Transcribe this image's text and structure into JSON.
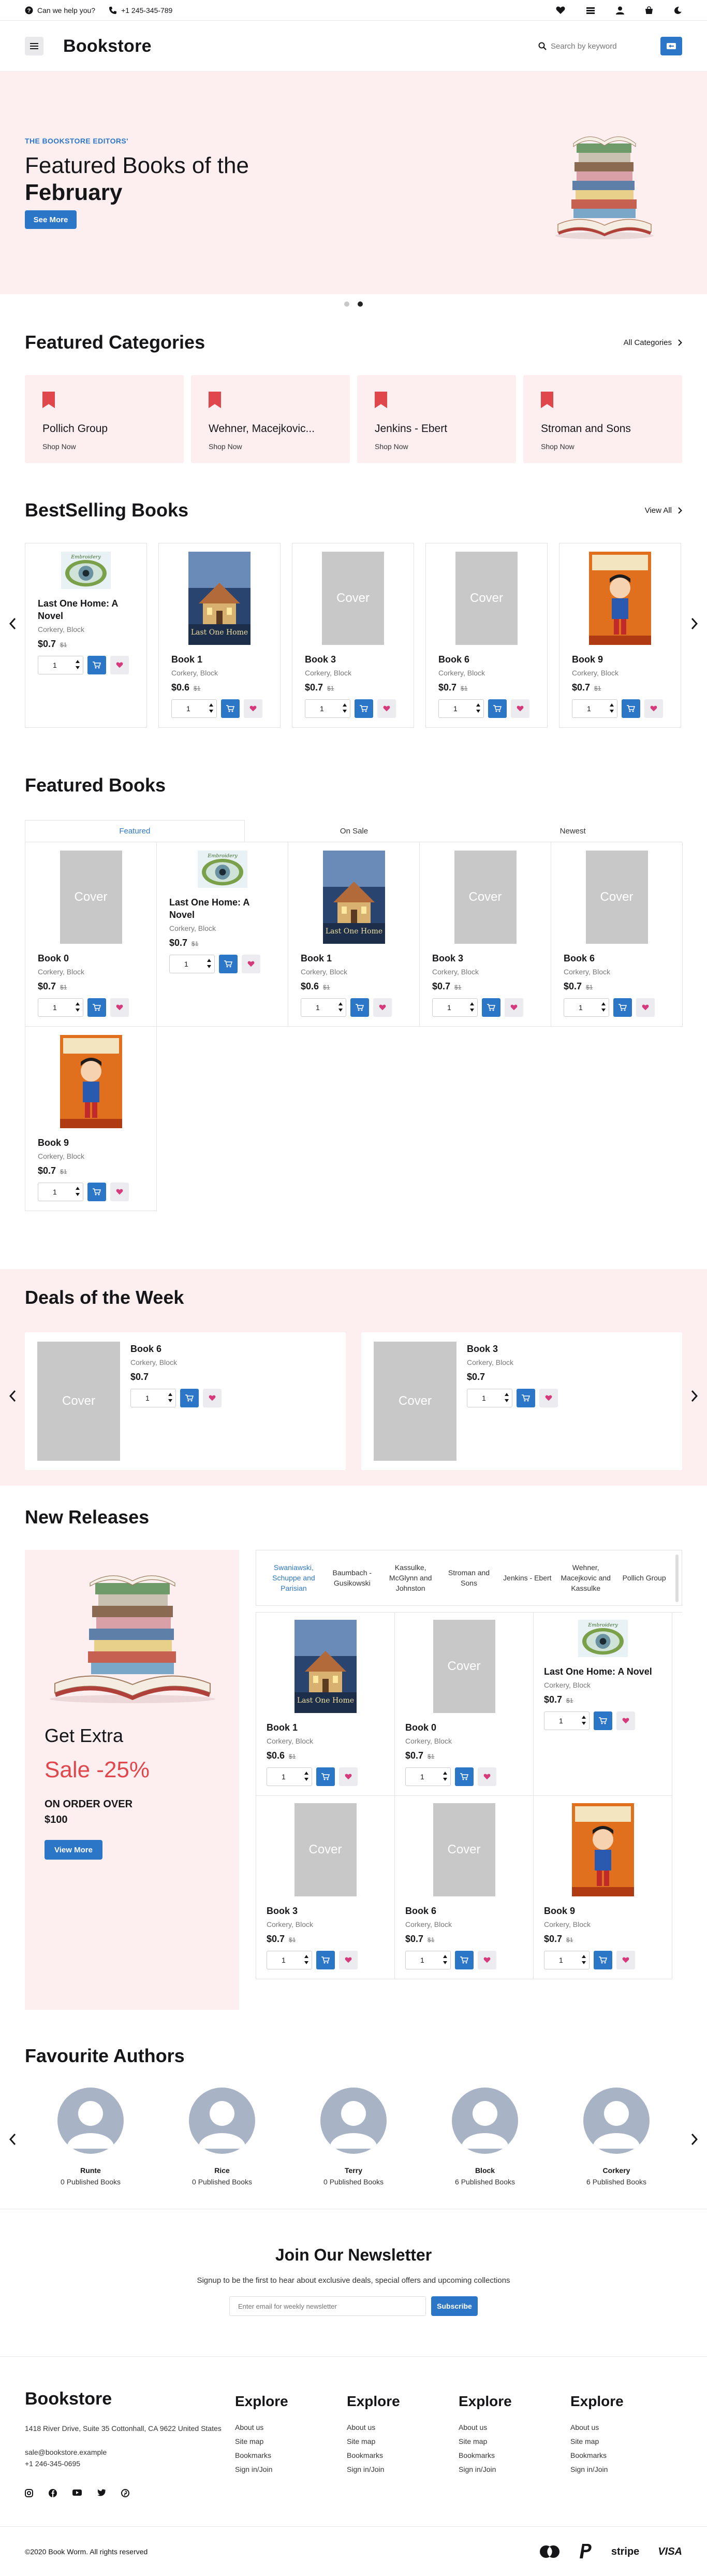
{
  "topbar": {
    "help": "Can we help you?",
    "phone": "+1 245-345-789"
  },
  "header": {
    "logo": "Bookstore",
    "search_placeholder": "Search by keyword"
  },
  "hero": {
    "eyebrow": "THE BOOKSTORE EDITORS'",
    "title_line1": "Featured Books of the",
    "title_line2": "February",
    "cta": "See More"
  },
  "categories": {
    "title": "Featured Categories",
    "link": "All Categories",
    "items": [
      {
        "name": "Pollich Group",
        "cta": "Shop Now"
      },
      {
        "name": "Wehner, Macejkovic...",
        "cta": "Shop Now"
      },
      {
        "name": "Jenkins - Ebert",
        "cta": "Shop Now"
      },
      {
        "name": "Stroman and Sons",
        "cta": "Shop Now"
      }
    ]
  },
  "bestselling": {
    "title": "BestSelling Books",
    "link": "View All",
    "items": [
      {
        "title": "Last One Home: A Novel",
        "author": "Corkery, Block",
        "price": "$0.7",
        "old": "$1",
        "qty": "1",
        "cover": "eye"
      },
      {
        "title": "Book 1",
        "author": "Corkery, Block",
        "price": "$0.6",
        "old": "$1",
        "qty": "1",
        "cover": "house",
        "cover_text": "Last One Home"
      },
      {
        "title": "Book 3",
        "author": "Corkery, Block",
        "price": "$0.7",
        "old": "$1",
        "qty": "1",
        "cover": "placeholder"
      },
      {
        "title": "Book 6",
        "author": "Corkery, Block",
        "price": "$0.7",
        "old": "$1",
        "qty": "1",
        "cover": "placeholder"
      },
      {
        "title": "Book 9",
        "author": "Corkery, Block",
        "price": "$0.7",
        "old": "$1",
        "qty": "1",
        "cover": "comic"
      }
    ]
  },
  "featured": {
    "title": "Featured Books",
    "tabs": [
      "Featured",
      "On Sale",
      "Newest"
    ],
    "items": [
      {
        "title": "Book 0",
        "author": "Corkery, Block",
        "price": "$0.7",
        "old": "$1",
        "qty": "1",
        "cover": "placeholder"
      },
      {
        "title": "Last One Home: A Novel",
        "author": "Corkery, Block",
        "price": "$0.7",
        "old": "$1",
        "qty": "1",
        "cover": "eye"
      },
      {
        "title": "Book 1",
        "author": "Corkery, Block",
        "price": "$0.6",
        "old": "$1",
        "qty": "1",
        "cover": "house",
        "cover_text": "Last One Home"
      },
      {
        "title": "Book 3",
        "author": "Corkery, Block",
        "price": "$0.7",
        "old": "$1",
        "qty": "1",
        "cover": "placeholder"
      },
      {
        "title": "Book 6",
        "author": "Corkery, Block",
        "price": "$0.7",
        "old": "$1",
        "qty": "1",
        "cover": "placeholder"
      },
      {
        "title": "Book 9",
        "author": "Corkery, Block",
        "price": "$0.7",
        "old": "$1",
        "qty": "1",
        "cover": "comic"
      }
    ]
  },
  "deals": {
    "title": "Deals of the Week",
    "items": [
      {
        "title": "Book 6",
        "author": "Corkery, Block",
        "price": "$0.7",
        "qty": "1"
      },
      {
        "title": "Book 3",
        "author": "Corkery, Block",
        "price": "$0.7",
        "qty": "1"
      }
    ]
  },
  "new_releases": {
    "title": "New Releases",
    "promo": {
      "extra": "Get Extra",
      "sale": "Sale -25%",
      "order_line1": "ON ORDER OVER",
      "order_line2": "$100",
      "cta": "View More"
    },
    "tabs": [
      "Swaniawski, Schuppe and Parisian",
      "Baumbach - Gusikowski",
      "Kassulke, McGlynn and Johnston",
      "Stroman and Sons",
      "Jenkins - Ebert",
      "Wehner, Macejkovic and Kassulke",
      "Pollich Group"
    ],
    "items": [
      {
        "title": "Book 1",
        "author": "Corkery, Block",
        "price": "$0.6",
        "old": "$1",
        "qty": "1",
        "cover": "house",
        "cover_text": "Last One Home"
      },
      {
        "title": "Book 0",
        "author": "Corkery, Block",
        "price": "$0.7",
        "old": "$1",
        "qty": "1",
        "cover": "placeholder"
      },
      {
        "title": "Last One Home: A Novel",
        "author": "Corkery, Block",
        "price": "$0.7",
        "old": "$1",
        "qty": "1",
        "cover": "eye"
      },
      {
        "title": "Book 3",
        "author": "Corkery, Block",
        "price": "$0.7",
        "old": "$1",
        "qty": "1",
        "cover": "placeholder"
      },
      {
        "title": "Book 6",
        "author": "Corkery, Block",
        "price": "$0.7",
        "old": "$1",
        "qty": "1",
        "cover": "placeholder"
      },
      {
        "title": "Book 9",
        "author": "Corkery, Block",
        "price": "$0.7",
        "old": "$1",
        "qty": "1",
        "cover": "comic"
      }
    ]
  },
  "authors": {
    "title": "Favourite Authors",
    "items": [
      {
        "name": "Runte",
        "books": "0 Published Books"
      },
      {
        "name": "Rice",
        "books": "0 Published Books"
      },
      {
        "name": "Terry",
        "books": "0 Published Books"
      },
      {
        "name": "Block",
        "books": "6 Published Books"
      },
      {
        "name": "Corkery",
        "books": "6 Published Books"
      }
    ]
  },
  "newsletter": {
    "title": "Join Our Newsletter",
    "text": "Signup to be the first to hear about exclusive deals, special offers and upcoming collections",
    "placeholder": "Enter email for weekly newsletter",
    "cta": "Subscribe"
  },
  "footer": {
    "logo": "Bookstore",
    "address": "1418 River Drive, Suite 35 Cottonhall, CA 9622 United States",
    "email": "sale@bookstore.example",
    "phone": "+1 246-345-0695",
    "columns": [
      {
        "title": "Explore",
        "links": [
          "About us",
          "Site map",
          "Bookmarks",
          "Sign in/Join"
        ]
      },
      {
        "title": "Explore",
        "links": [
          "About us",
          "Site map",
          "Bookmarks",
          "Sign in/Join"
        ]
      },
      {
        "title": "Explore",
        "links": [
          "About us",
          "Site map",
          "Bookmarks",
          "Sign in/Join"
        ]
      },
      {
        "title": "Explore",
        "links": [
          "About us",
          "Site map",
          "Bookmarks",
          "Sign in/Join"
        ]
      }
    ],
    "copyright": "©2020 Book Worm. All rights reserved",
    "payments": [
      "mastercard",
      "paypal",
      "stripe",
      "VISA"
    ],
    "payment_labels": {
      "stripe": "stripe",
      "visa": "VISA"
    }
  },
  "colors": {
    "accent": "#2c76c7",
    "pink_bg": "#fdeff0",
    "sale_red": "#e0474c",
    "bookmark_red": "#e0474c",
    "heart": "#d63a7a"
  },
  "cover_placeholder": "Cover"
}
